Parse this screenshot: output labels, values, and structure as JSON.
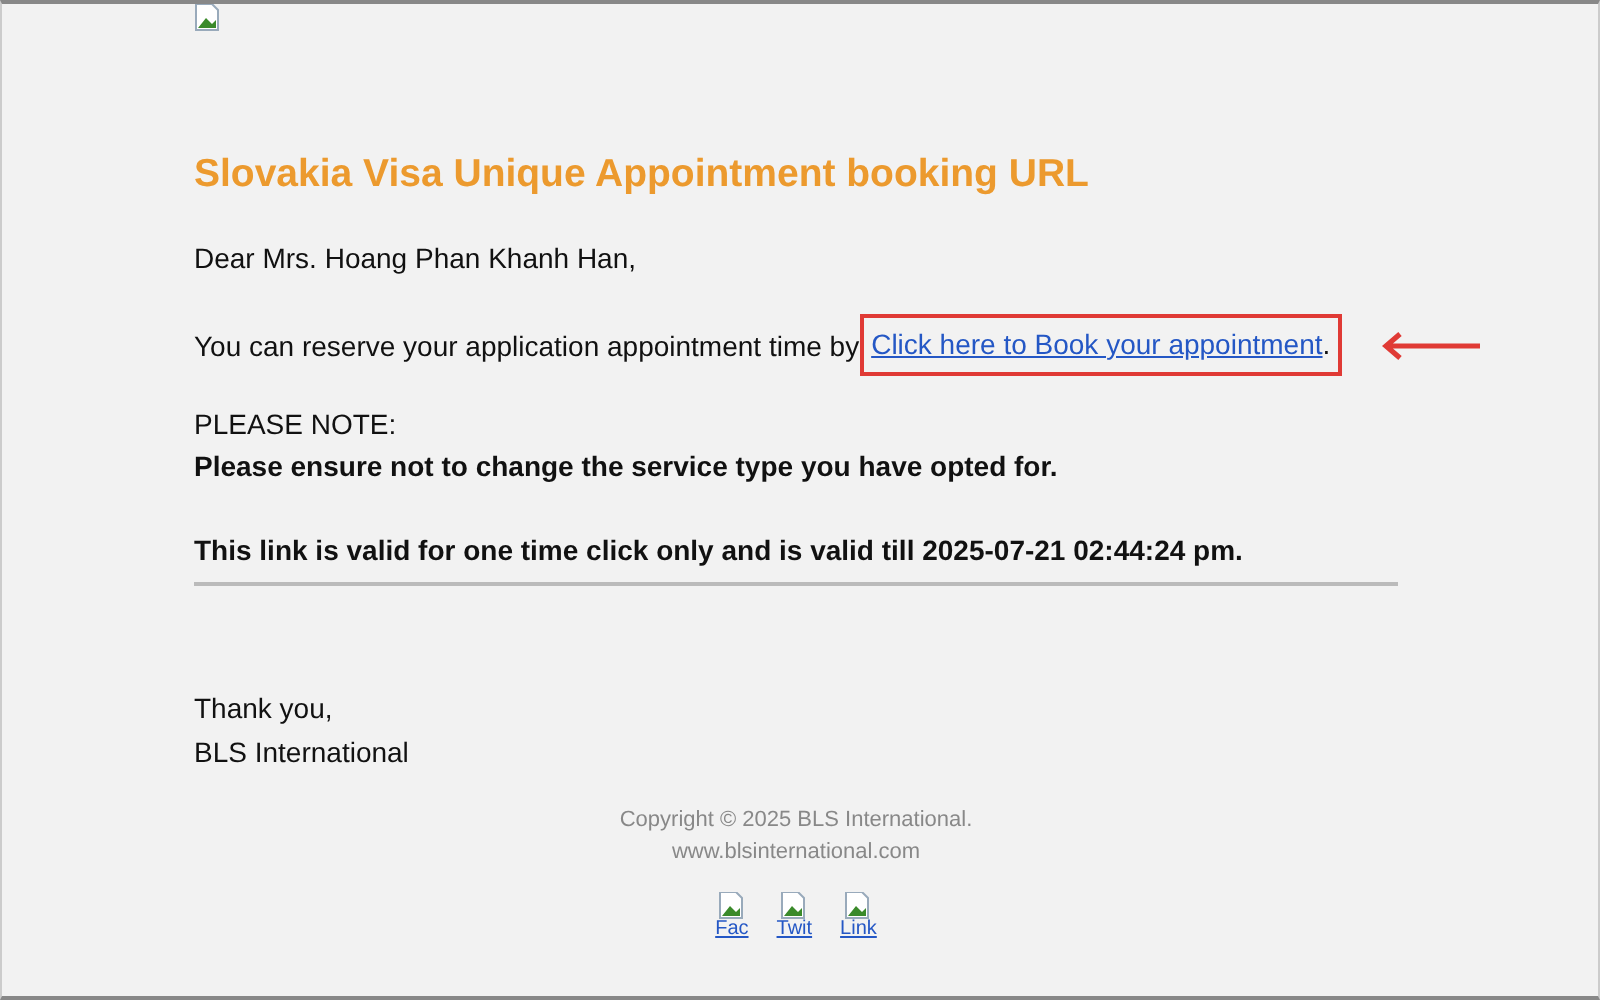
{
  "title": "Slovakia Visa Unique Appointment booking URL",
  "greeting": "Dear Mrs. Hoang Phan Khanh Han,",
  "message": {
    "prefix": "You can reserve your application appointment time by ",
    "link": "Click here to Book your appointment",
    "suffix": ".",
    "highlighted": true
  },
  "note_heading": "PLEASE NOTE:",
  "note_lines": [
    "Please ensure not to change the service type you have opted for.",
    "This link is valid for one time click only and is valid till 2025-07-21 02:44:24 pm."
  ],
  "signoff": [
    "Thank you,",
    "BLS International"
  ],
  "footer": {
    "copyright": "Copyright © 2025 BLS International.",
    "website": "www.blsinternational.com"
  },
  "social_links": [
    {
      "label": "Fac"
    },
    {
      "label": "Twit"
    },
    {
      "label": "Link"
    }
  ]
}
